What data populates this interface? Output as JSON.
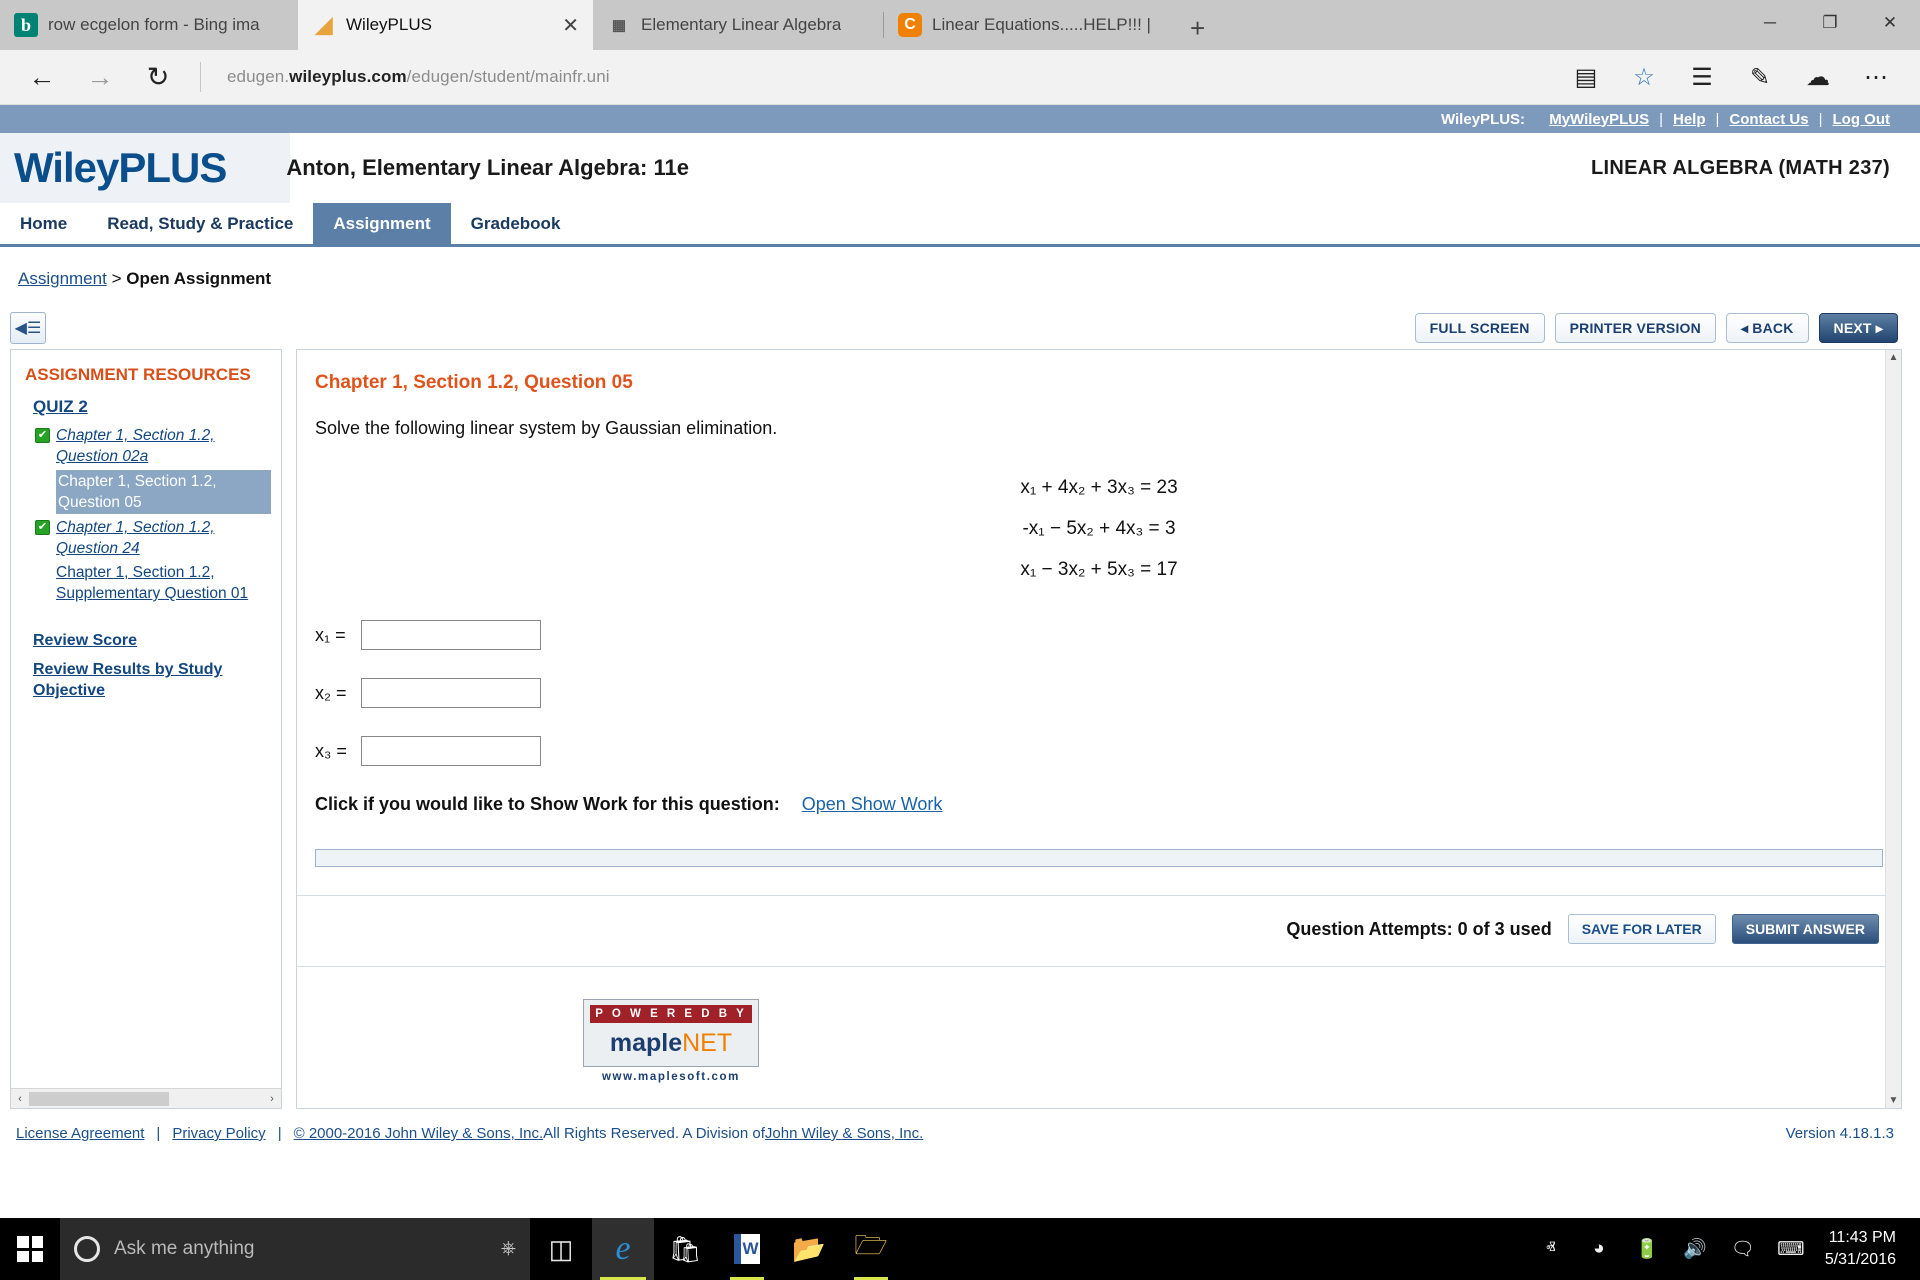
{
  "browser": {
    "tabs": [
      {
        "title": "row ecgelon form - Bing ima",
        "favicon": "bing-icon",
        "active": false
      },
      {
        "title": "WileyPLUS",
        "favicon": "wileyplus-icon",
        "active": true
      },
      {
        "title": "Elementary Linear Algebra",
        "favicon": "page-icon",
        "active": false
      },
      {
        "title": "Linear Equations.....HELP!!! | ",
        "favicon": "chegg-icon",
        "active": false
      }
    ],
    "new_tab_label": "+",
    "close_label": "✕",
    "window_controls": {
      "minimize": "─",
      "maximize": "❐",
      "close": "✕"
    },
    "nav": {
      "back": "←",
      "forward": "→",
      "refresh": "↻",
      "url_prefix": "edugen.",
      "url_domain": "wileyplus.com",
      "url_path": "/edugen/student/mainfr.uni",
      "reading_view": "▤",
      "favorite": "☆",
      "hub": "☰",
      "note": "✎",
      "share": "☁",
      "more": "⋯"
    }
  },
  "topbar": {
    "label": "WileyPLUS:",
    "links": [
      "MyWileyPLUS",
      "Help",
      "Contact Us",
      "Log Out"
    ],
    "separator": "|"
  },
  "brand": {
    "logo": "WileyPLUS",
    "course_title": "Anton, Elementary Linear Algebra: 11e",
    "course_code": "LINEAR ALGEBRA (MATH 237)"
  },
  "navtabs": [
    {
      "label": "Home",
      "selected": false
    },
    {
      "label": "Read, Study & Practice",
      "selected": false
    },
    {
      "label": "Assignment",
      "selected": true
    },
    {
      "label": "Gradebook",
      "selected": false
    }
  ],
  "breadcrumb": {
    "link": "Assignment",
    "separator": ">",
    "current": "Open Assignment"
  },
  "toolbar": {
    "collapse_icon": "◀☰",
    "full_screen": "FULL SCREEN",
    "printer_version": "PRINTER VERSION",
    "back": "◂ BACK",
    "next": "NEXT ▸"
  },
  "sidebar": {
    "title": "ASSIGNMENT RESOURCES",
    "quiz_label": "QUIZ 2",
    "items": [
      {
        "label": "Chapter 1, Section 1.2, Question 02a",
        "completed": true,
        "current": false
      },
      {
        "label": "Chapter 1, Section 1.2, Question 05",
        "completed": false,
        "current": true
      },
      {
        "label": "Chapter 1, Section 1.2, Question 24",
        "completed": true,
        "current": false
      },
      {
        "label": "Chapter 1, Section 1.2, Supplementary Question 01",
        "completed": false,
        "current": false
      }
    ],
    "check_glyph": "✔",
    "reviews": [
      "Review Score",
      "Review Results by Study Objective"
    ],
    "scroll_left": "‹",
    "scroll_right": "›"
  },
  "question": {
    "heading": "Chapter 1, Section 1.2, Question 05",
    "prompt": "Solve the following linear system by Gaussian elimination.",
    "equations": [
      {
        "lhs": "x₁ + 4x₂ + 3x₃",
        "eq": "=",
        "rhs": "23"
      },
      {
        "lhs": "-x₁ − 5x₂ + 4x₃",
        "eq": "=",
        "rhs": "3"
      },
      {
        "lhs": "x₁ − 3x₂ + 5x₃",
        "eq": "=",
        "rhs": "17"
      }
    ],
    "answers": [
      {
        "label": "x₁ =",
        "value": "",
        "placeholder": ""
      },
      {
        "label": "x₂ =",
        "value": "",
        "placeholder": ""
      },
      {
        "label": "x₃ =",
        "value": "",
        "placeholder": ""
      }
    ],
    "showwork_label": "Click if you would like to Show Work for this question:",
    "showwork_link": "Open Show Work",
    "attempts_text": "Question Attempts: 0 of 3 used",
    "save_label": "SAVE FOR LATER",
    "submit_label": "SUBMIT ANSWER"
  },
  "maple": {
    "powered_by": "P O W E R E D  B Y",
    "name_1": "maple",
    "name_2": "NET",
    "url": "www.maplesoft.com"
  },
  "footer": {
    "license": "License Agreement",
    "privacy": "Privacy Policy",
    "copyright_link": "© 2000-2016 John Wiley & Sons, Inc.",
    "rights": " All Rights Reserved. A Division of ",
    "division_link": "John Wiley & Sons, Inc.",
    "separator": "|",
    "version": "Version 4.18.1.3"
  },
  "taskbar": {
    "search_placeholder": "Ask me anything",
    "mic_icon": "ᵕ",
    "taskview_icon": "⬚",
    "apps": [
      "edge-icon",
      "store-icon",
      "word-icon",
      "folder-icon",
      "explorer-icon"
    ],
    "tray": {
      "chevron": "ⱏ",
      "wifi": "wifi-icon",
      "battery": "battery-icon",
      "volume": "volume-icon",
      "action_center": "action-center-icon",
      "keyboard": "keyboard-icon"
    },
    "time": "11:43 PM",
    "date": "5/31/2016"
  },
  "colors": {
    "accent_blue": "#7d9abd",
    "brand_blue": "#0b4e8c",
    "heading_orange": "#e0531c",
    "link_blue": "#1b4f8a",
    "check_green": "#26a326"
  }
}
